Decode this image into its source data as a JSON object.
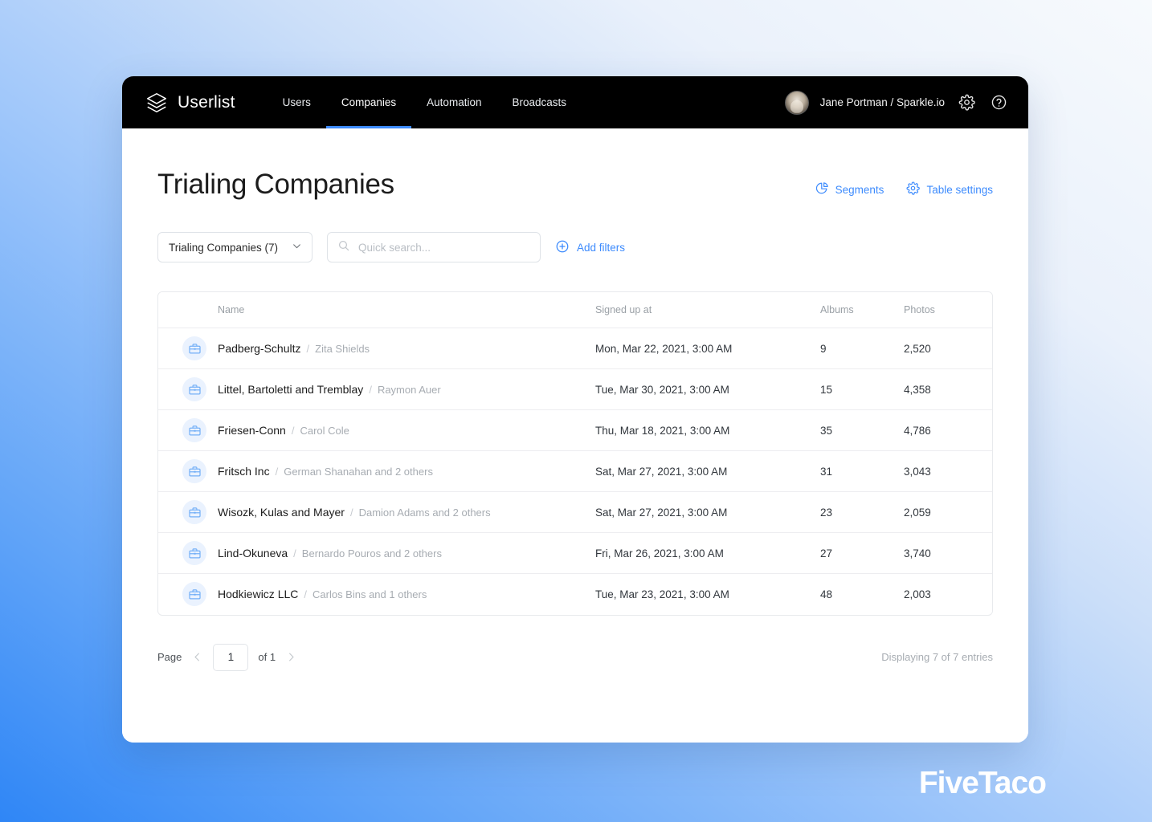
{
  "brand": {
    "name": "Userlist",
    "logo_icon": "layers-stack-icon"
  },
  "nav": {
    "items": [
      {
        "label": "Users",
        "active": false
      },
      {
        "label": "Companies",
        "active": true
      },
      {
        "label": "Automation",
        "active": false
      },
      {
        "label": "Broadcasts",
        "active": false
      }
    ],
    "user": {
      "name": "Jane Portman / Sparkle.io",
      "avatar_icon": "avatar"
    },
    "settings_icon": "gear-icon",
    "help_icon": "question-circle-icon"
  },
  "header": {
    "title": "Trialing Companies",
    "actions": [
      {
        "label": "Segments",
        "icon": "pie-chart-icon"
      },
      {
        "label": "Table settings",
        "icon": "gear-icon"
      }
    ]
  },
  "toolbar": {
    "segment_value": "Trialing Companies (7)",
    "segment_caret_icon": "chevron-down-icon",
    "search_placeholder": "Quick search...",
    "search_value": "",
    "search_icon": "search-icon",
    "add_filters_label": "Add filters",
    "add_filters_icon": "plus-circle-icon"
  },
  "table": {
    "columns": [
      "Name",
      "Signed up at",
      "Albums",
      "Photos"
    ],
    "rows": [
      {
        "icon": "briefcase-icon",
        "company": "Padberg-Schultz",
        "sep": "/",
        "contact": "Zita Shields",
        "signed_up_at": "Mon, Mar 22, 2021, 3:00 AM",
        "albums": "9",
        "photos": "2,520"
      },
      {
        "icon": "briefcase-icon",
        "company": "Littel, Bartoletti and Tremblay",
        "sep": "/",
        "contact": "Raymon Auer",
        "signed_up_at": "Tue, Mar 30, 2021, 3:00 AM",
        "albums": "15",
        "photos": "4,358"
      },
      {
        "icon": "briefcase-icon",
        "company": "Friesen-Conn",
        "sep": "/",
        "contact": "Carol Cole",
        "signed_up_at": "Thu, Mar 18, 2021, 3:00 AM",
        "albums": "35",
        "photos": "4,786"
      },
      {
        "icon": "briefcase-icon",
        "company": "Fritsch Inc",
        "sep": "/",
        "contact": "German Shanahan and 2 others",
        "signed_up_at": "Sat, Mar 27, 2021, 3:00 AM",
        "albums": "31",
        "photos": "3,043"
      },
      {
        "icon": "briefcase-icon",
        "company": "Wisozk, Kulas and Mayer",
        "sep": "/",
        "contact": "Damion Adams and 2 others",
        "signed_up_at": "Sat, Mar 27, 2021, 3:00 AM",
        "albums": "23",
        "photos": "2,059"
      },
      {
        "icon": "briefcase-icon",
        "company": "Lind-Okuneva",
        "sep": "/",
        "contact": "Bernardo Pouros and 2 others",
        "signed_up_at": "Fri, Mar 26, 2021, 3:00 AM",
        "albums": "27",
        "photos": "3,740"
      },
      {
        "icon": "briefcase-icon",
        "company": "Hodkiewicz LLC",
        "sep": "/",
        "contact": "Carlos Bins and 1 others",
        "signed_up_at": "Tue, Mar 23, 2021, 3:00 AM",
        "albums": "48",
        "photos": "2,003"
      }
    ]
  },
  "pagination": {
    "page_label": "Page",
    "page_value": "1",
    "of_label": "of 1",
    "prev_icon": "chevron-left-icon",
    "next_icon": "chevron-right-icon",
    "entries_label": "Displaying 7 of 7 entries"
  },
  "watermark": {
    "text": "FiveTaco"
  },
  "colors": {
    "accent": "#3d8bfd",
    "nav_background": "#000000",
    "page_background": "#ffffff",
    "row_icon_background": "#eaf2fe",
    "muted_text": "#a7acb2"
  }
}
